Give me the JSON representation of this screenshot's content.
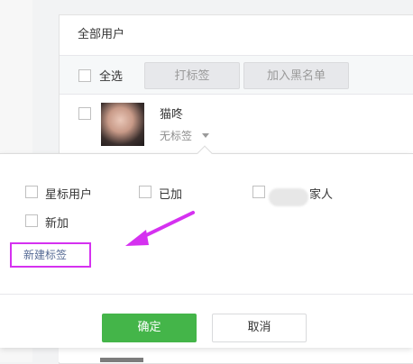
{
  "panel": {
    "header_title": "全部用户",
    "toolbar": {
      "select_all_label": "全选",
      "tag_button_label": "打标签",
      "blacklist_button_label": "加入黑名单"
    },
    "user": {
      "name": "猫咚",
      "tag": "无标签"
    }
  },
  "tag_popup": {
    "options": [
      {
        "label": "星标用户",
        "checked": false
      },
      {
        "label": "已加",
        "checked": false
      },
      {
        "label": "家人",
        "checked": false
      },
      {
        "label": "新加",
        "checked": false
      }
    ],
    "new_tag_link": "新建标签",
    "confirm_label": "确定",
    "cancel_label": "取消"
  },
  "colors": {
    "confirm_green": "#44b549",
    "annotation_magenta": "#d531f0",
    "link_blue": "#576b95"
  },
  "icons": [
    "checkbox-icon",
    "chevron-down-icon",
    "annotation-arrow-icon"
  ]
}
